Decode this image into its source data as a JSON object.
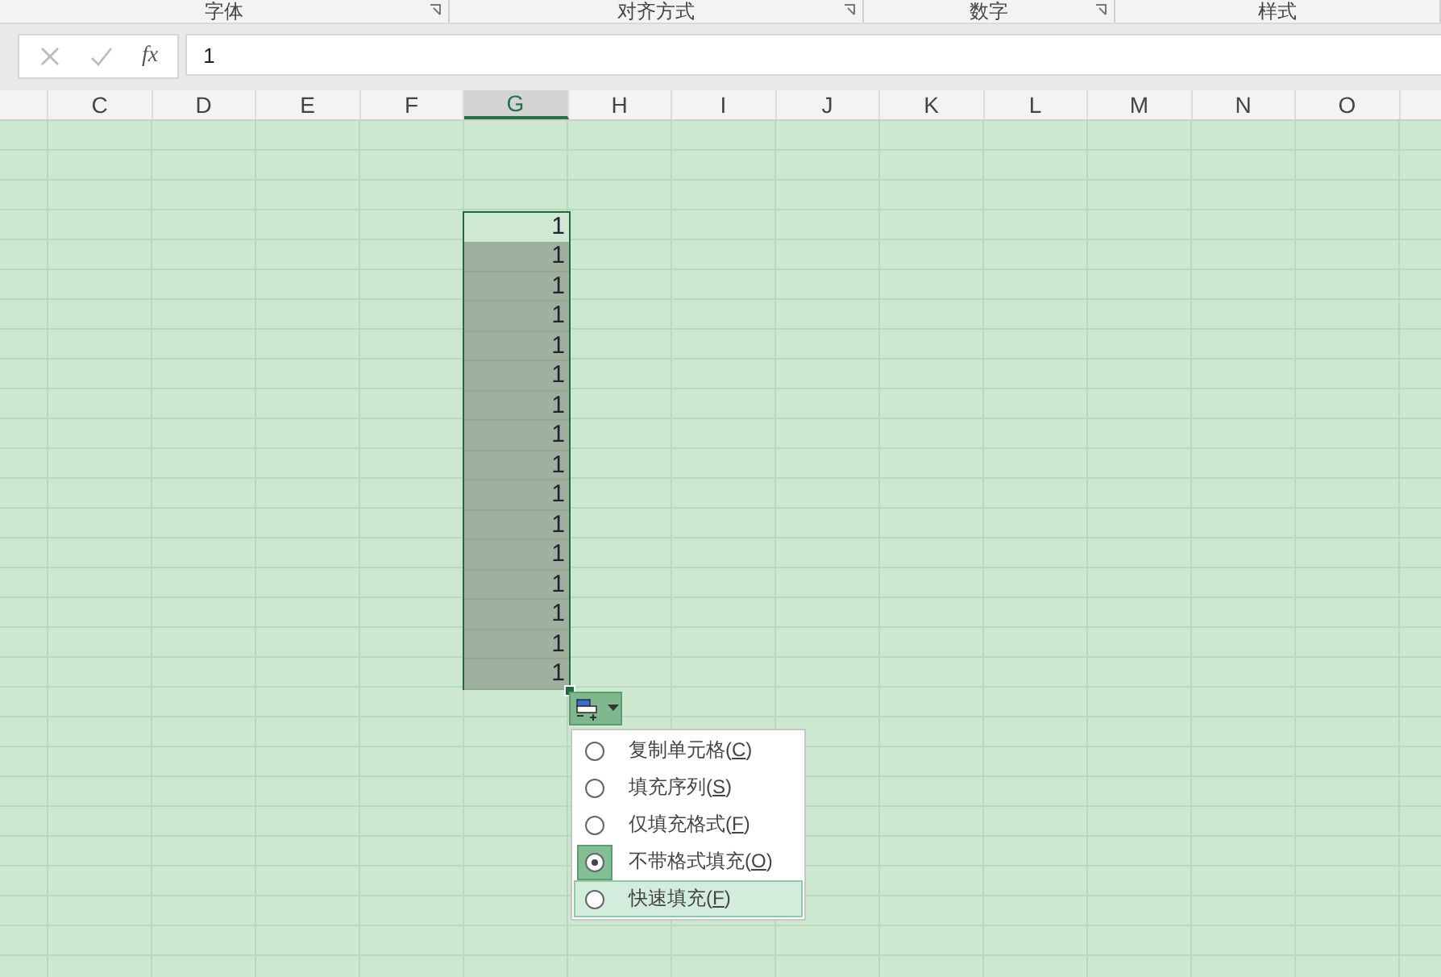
{
  "ribbon_groups": [
    {
      "label": "字体",
      "launcher": true
    },
    {
      "label": "对齐方式",
      "launcher": true
    },
    {
      "label": "数字",
      "launcher": true
    },
    {
      "label": "样式",
      "launcher": false
    }
  ],
  "formula_bar": {
    "function_label": "fx",
    "value": "1"
  },
  "columns": [
    {
      "label": "C",
      "selected": false
    },
    {
      "label": "D",
      "selected": false
    },
    {
      "label": "E",
      "selected": false
    },
    {
      "label": "F",
      "selected": false
    },
    {
      "label": "G",
      "selected": true
    },
    {
      "label": "H",
      "selected": false
    },
    {
      "label": "I",
      "selected": false
    },
    {
      "label": "J",
      "selected": false
    },
    {
      "label": "K",
      "selected": false
    },
    {
      "label": "L",
      "selected": false
    },
    {
      "label": "M",
      "selected": false
    },
    {
      "label": "N",
      "selected": false
    },
    {
      "label": "O",
      "selected": false
    }
  ],
  "cells": [
    {
      "value": "1",
      "active": true
    },
    {
      "value": "1",
      "active": false
    },
    {
      "value": "1",
      "active": false
    },
    {
      "value": "1",
      "active": false
    },
    {
      "value": "1",
      "active": false
    },
    {
      "value": "1",
      "active": false
    },
    {
      "value": "1",
      "active": false
    },
    {
      "value": "1",
      "active": false
    },
    {
      "value": "1",
      "active": false
    },
    {
      "value": "1",
      "active": false
    },
    {
      "value": "1",
      "active": false
    },
    {
      "value": "1",
      "active": false
    },
    {
      "value": "1",
      "active": false
    },
    {
      "value": "1",
      "active": false
    },
    {
      "value": "1",
      "active": false
    },
    {
      "value": "1",
      "active": false
    }
  ],
  "fill_options": [
    {
      "label": "复制单元格(C)",
      "selected": false,
      "hovered": false
    },
    {
      "label": "填充序列(S)",
      "selected": false,
      "hovered": false
    },
    {
      "label": "仅填充格式(F)",
      "selected": false,
      "hovered": false
    },
    {
      "label": "不带格式填充(O)",
      "selected": true,
      "hovered": false
    },
    {
      "label": "快速填充(F)",
      "selected": false,
      "hovered": true
    }
  ]
}
